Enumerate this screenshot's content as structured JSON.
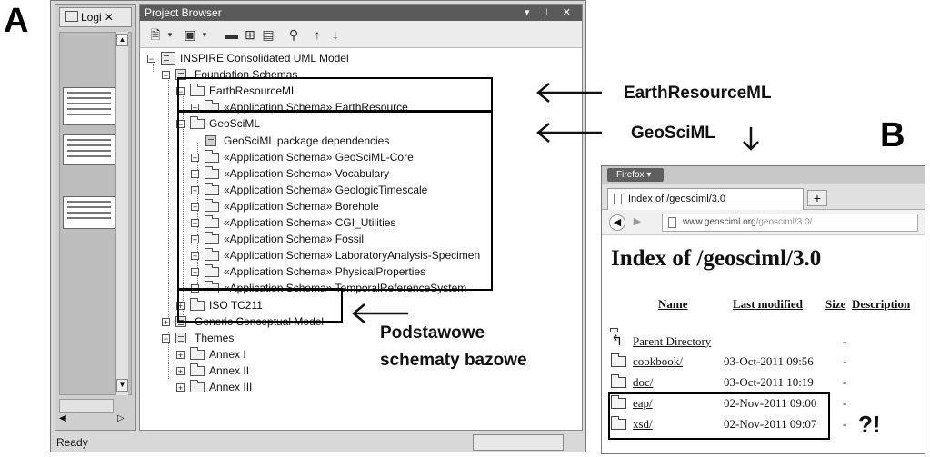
{
  "labels": {
    "a": "A",
    "b": "B"
  },
  "nav": {
    "tab": "Logi"
  },
  "project_browser": {
    "title": "Project Browser",
    "controls": "▾ ⫫ ✕",
    "tree": [
      {
        "text": "INSPIRE Consolidated UML Model",
        "exp": "−"
      },
      {
        "text": "Foundation Schemas",
        "exp": "−"
      },
      {
        "text": "EarthResourceML",
        "exp": "−"
      },
      {
        "text": "«Application Schema» EarthResource",
        "exp": "+"
      },
      {
        "text": "GeoSciML",
        "exp": "−"
      },
      {
        "text": "GeoSciML package dependencies",
        "exp": ""
      },
      {
        "text": "«Application Schema» GeoSciML-Core",
        "exp": "+"
      },
      {
        "text": "«Application Schema» Vocabulary",
        "exp": "+"
      },
      {
        "text": "«Application Schema» GeologicTimescale",
        "exp": "+"
      },
      {
        "text": "«Application Schema» Borehole",
        "exp": "+"
      },
      {
        "text": "«Application Schema» CGI_Utilities",
        "exp": "+"
      },
      {
        "text": "«Application Schema» Fossil",
        "exp": "+"
      },
      {
        "text": "«Application Schema» LaboratoryAnalysis-Specimen",
        "exp": "+"
      },
      {
        "text": "«Application Schema» PhysicalProperties",
        "exp": "+"
      },
      {
        "text": "«Application Schema» TemporalReferenceSystem",
        "exp": "+"
      },
      {
        "text": "ISO TC211",
        "exp": "+"
      },
      {
        "text": "Generic Conceptual Model",
        "exp": "+"
      },
      {
        "text": "Themes",
        "exp": "−"
      },
      {
        "text": "Annex I",
        "exp": "+"
      },
      {
        "text": "Annex II",
        "exp": "+"
      },
      {
        "text": "Annex III",
        "exp": "+"
      }
    ]
  },
  "status": {
    "text": "Ready"
  },
  "annotations": {
    "earthresourceml": "EarthResourceML",
    "geosciml": "GeoSciML",
    "podstawowe_1": "Podstawowe",
    "podstawowe_2": "schematy bazowe",
    "question": "?!"
  },
  "firefox": {
    "menu": "Firefox ▾",
    "tab_title": "Index of /geosciml/3.0",
    "new_tab": "+",
    "url_domain": "www.geosciml.org",
    "url_path": "/geosciml/3.0/",
    "page_title": "Index of /geosciml/3.0",
    "columns": {
      "name": "Name",
      "modified": "Last modified",
      "size": "Size",
      "description": "Description"
    },
    "rows": [
      {
        "name": "Parent Directory",
        "date": "",
        "size": "-"
      },
      {
        "name": "cookbook/",
        "date": "03-Oct-2011 09:56",
        "size": "-"
      },
      {
        "name": "doc/",
        "date": "03-Oct-2011 10:19",
        "size": "-"
      },
      {
        "name": "eap/",
        "date": "02-Nov-2011 09:00",
        "size": "-"
      },
      {
        "name": "xsd/",
        "date": "02-Nov-2011 09:07",
        "size": "-"
      }
    ]
  }
}
